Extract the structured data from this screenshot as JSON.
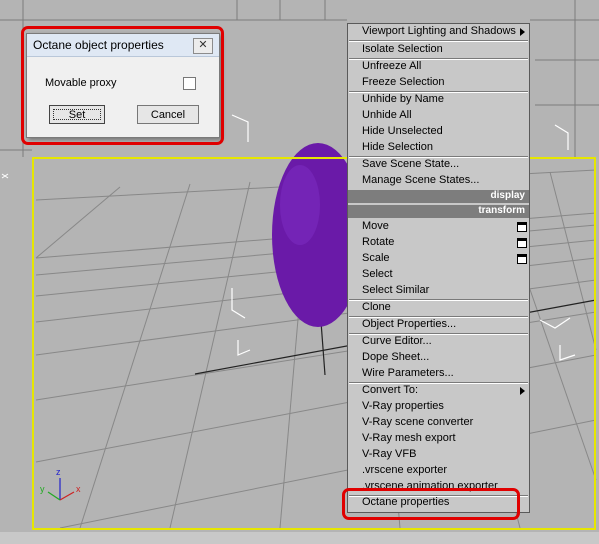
{
  "dialog": {
    "title": "Octane object properties",
    "close_label": "✕",
    "movable_proxy_label": "Movable proxy",
    "movable_proxy_checked": false,
    "set_label": "Set",
    "cancel_label": "Cancel"
  },
  "viewport": {
    "sphere_color": "#6a1aa8",
    "frame_color": "#e6e600",
    "highlight_color": "#e00000"
  },
  "menu": {
    "headers": {
      "display": "display",
      "transform": "transform"
    },
    "items": {
      "viewport_lighting": "Viewport Lighting and Shadows",
      "isolate_selection": "Isolate Selection",
      "unfreeze_all": "Unfreeze All",
      "freeze_selection": "Freeze Selection",
      "unhide_by_name": "Unhide by Name",
      "unhide_all": "Unhide All",
      "hide_unselected": "Hide Unselected",
      "hide_selection": "Hide Selection",
      "save_scene_state": "Save Scene State...",
      "manage_scene_states": "Manage Scene States...",
      "move": "Move",
      "rotate": "Rotate",
      "scale": "Scale",
      "select": "Select",
      "select_similar": "Select Similar",
      "clone": "Clone",
      "object_properties": "Object Properties...",
      "curve_editor": "Curve Editor...",
      "dope_sheet": "Dope Sheet...",
      "wire_parameters": "Wire Parameters...",
      "convert_to": "Convert To:",
      "vray_properties": "V-Ray properties",
      "vray_scene_converter": "V-Ray scene converter",
      "vray_mesh_export": "V-Ray mesh export",
      "vray_vfb": "V-Ray VFB",
      "vrscene_exporter": ".vrscene exporter",
      "vrscene_animation_exporter": ".vrscene animation exporter",
      "octane_properties": "Octane properties"
    }
  }
}
